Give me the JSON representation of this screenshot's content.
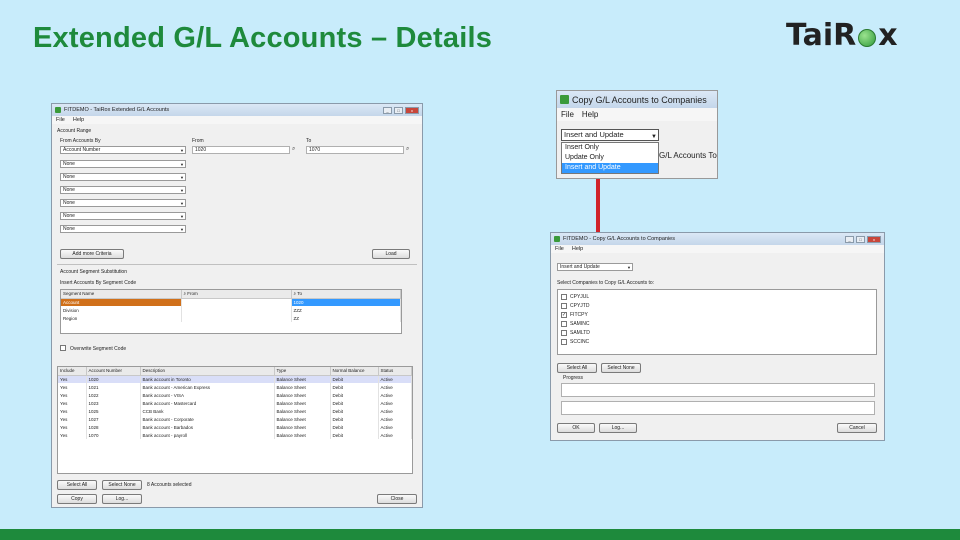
{
  "slide": {
    "title": "Extended G/L Accounts – Details",
    "logo_left": "Tai",
    "logo_mid": "R",
    "logo_right": "x"
  },
  "main_win": {
    "title": "FITDEMO - TaiRox Extended G/L Accounts",
    "menu": [
      "File",
      "Help"
    ],
    "account_range_label": "Account Range",
    "from_accounts_by_label": "From Accounts By",
    "from_label": "From",
    "to_label": "To",
    "order_by": "Account Number",
    "from_value": "1020",
    "to_value": "1070",
    "segment_combos": [
      "None",
      "None",
      "None",
      "None",
      "None",
      "None"
    ],
    "add_criteria_label": "Add more Criteria",
    "load_label": "Load",
    "segment_sub_label": "Account Segment Substitution",
    "insert_by_label": "Insert Accounts By Segment Code",
    "seg_headers": [
      "Segment Name",
      "From",
      "To"
    ],
    "seg_rows": [
      [
        "Account",
        "",
        "1020"
      ],
      [
        "Division",
        "",
        "ZZZ"
      ],
      [
        "Region",
        "",
        "ZZ"
      ]
    ],
    "overwrite_label": "Overwrite Segment Code",
    "acct_headers": [
      "Include",
      "Account Number",
      "Description",
      "Type",
      "Normal Balance",
      "Status"
    ],
    "acct_rows": [
      [
        "Yes",
        "1020",
        "Bank account in Toronto",
        "Balance Sheet",
        "Debit",
        "Active"
      ],
      [
        "Yes",
        "1021",
        "Bank account - American Express",
        "Balance Sheet",
        "Debit",
        "Active"
      ],
      [
        "Yes",
        "1022",
        "Bank account - VISA",
        "Balance Sheet",
        "Debit",
        "Active"
      ],
      [
        "Yes",
        "1023",
        "Bank account - Mastercard",
        "Balance Sheet",
        "Debit",
        "Active"
      ],
      [
        "Yes",
        "1025",
        "CCB Bank",
        "Balance Sheet",
        "Debit",
        "Active"
      ],
      [
        "Yes",
        "1027",
        "Bank account - Corporate",
        "Balance Sheet",
        "Debit",
        "Active"
      ],
      [
        "Yes",
        "1028",
        "Bank account - Barbados",
        "Balance Sheet",
        "Debit",
        "Active"
      ],
      [
        "Yes",
        "1070",
        "Bank account - payroll",
        "Balance Sheet",
        "Debit",
        "Active"
      ]
    ],
    "select_all_label": "Select All",
    "select_none_label": "Select None",
    "count_text": "8 Accounts selected",
    "copy_label": "Copy",
    "log_label": "Log...",
    "close_label": "Close"
  },
  "dropdown_win": {
    "title": "Copy G/L Accounts to Companies",
    "menu": [
      "File",
      "Help"
    ],
    "combo_value": "Insert and Update",
    "options": [
      "Insert Only",
      "Update Only",
      "Insert and Update"
    ],
    "selected_index": 2,
    "behind_text": "G/L Accounts To"
  },
  "copy_win": {
    "title": "FITDEMO - Copy G/L Accounts to Companies",
    "menu": [
      "File",
      "Help"
    ],
    "combo_value": "Insert and Update",
    "select_companies_label": "Select Companies to Copy G/L Accounts to:",
    "companies": [
      {
        "name": "CPYJUL",
        "checked": false
      },
      {
        "name": "CPYJTD",
        "checked": false
      },
      {
        "name": "FITCPY",
        "checked": true
      },
      {
        "name": "SAMINC",
        "checked": false
      },
      {
        "name": "SAMLTD",
        "checked": false
      },
      {
        "name": "SCCINC",
        "checked": false
      }
    ],
    "check_glyph": "✓",
    "select_all_label": "Select All",
    "select_none_label": "Select None",
    "progress_label": "Progress",
    "ok_label": "OK",
    "log_label": "Log...",
    "cancel_label": "Cancel"
  }
}
